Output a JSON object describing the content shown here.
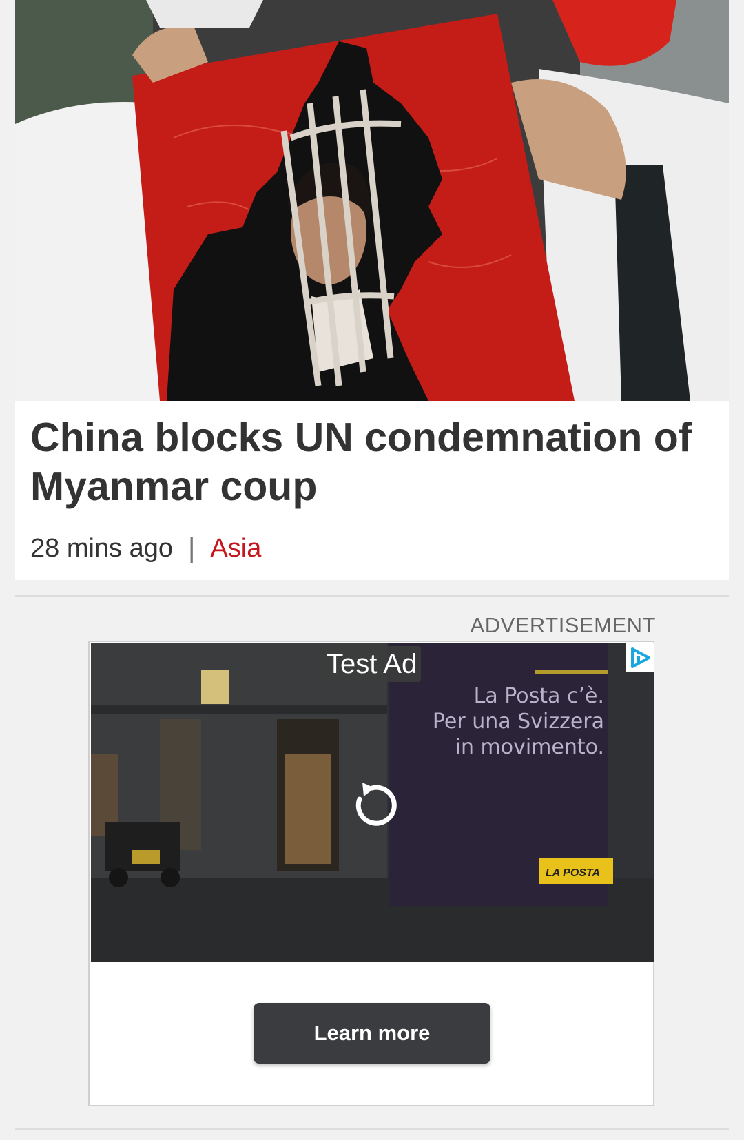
{
  "article": {
    "headline": "China blocks UN condemnation of Myanmar coup",
    "time_ago": "28 mins ago",
    "separator": "|",
    "category": "Asia",
    "category_color": "#c4161c",
    "image_alt": "Protester holding a red poster of Myanmar map with a portrait behind bars"
  },
  "ad": {
    "label": "ADVERTISEMENT",
    "badge": "Test Ad",
    "adchoices_icon": "adchoices-icon",
    "replay_icon": "replay-icon",
    "copy_lines": [
      "La Posta c’è.",
      "Per una Svizzera",
      "in movimento."
    ],
    "brand": "LA POSTA",
    "cta": "Learn more"
  }
}
